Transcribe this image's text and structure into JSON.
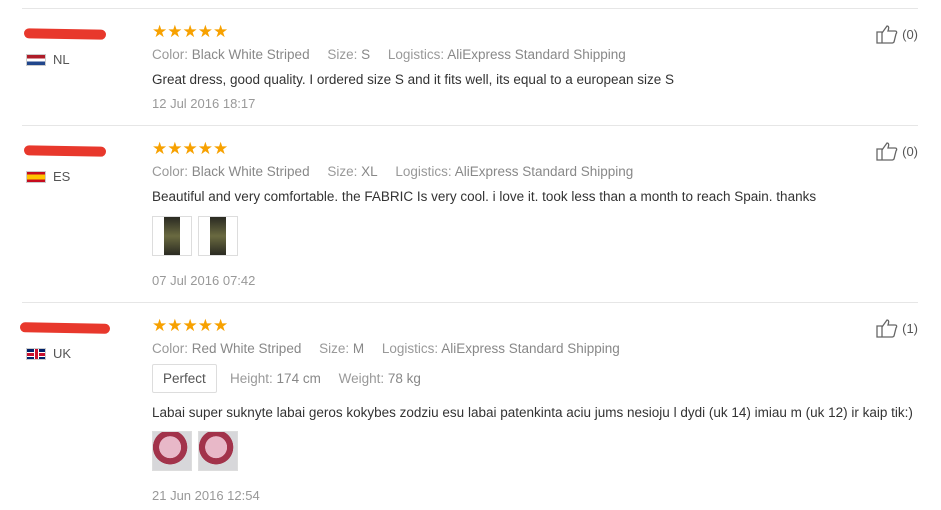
{
  "labels": {
    "color": "Color:",
    "size": "Size:",
    "logistics": "Logistics:",
    "height": "Height:",
    "weight": "Weight:"
  },
  "reviews": [
    {
      "country": "NL",
      "stars": "★★★★★",
      "color": "Black White Striped",
      "size": "S",
      "logistics": "AliExpress Standard Shipping",
      "text": "Great dress, good quality. I ordered size S and it fits well, its equal to a european size S",
      "date": "12 Jul 2016 18:17",
      "helpful": "(0)"
    },
    {
      "country": "ES",
      "stars": "★★★★★",
      "color": "Black White Striped",
      "size": "XL",
      "logistics": "AliExpress Standard Shipping",
      "text": "Beautiful and very comfortable. the FABRIC Is very cool. i love it. took less than a month to reach Spain. thanks",
      "date": "07 Jul 2016 07:42",
      "helpful": "(0)"
    },
    {
      "country": "UK",
      "stars": "★★★★★",
      "color": "Red White Striped",
      "size": "M",
      "logistics": "AliExpress Standard Shipping",
      "fit": "Perfect",
      "height": "174 cm",
      "weight": "78 kg",
      "text": "Labai super suknyte labai geros kokybes zodziu esu labai patenkinta aciu jums nesioju l dydi (uk 14) imiau m (uk 12) ir kaip tik:)",
      "date": "21 Jun 2016 12:54",
      "helpful": "(1)"
    }
  ],
  "icons": {
    "like": "thumbs-up-icon",
    "photo": "review-photo"
  },
  "colors": {
    "stars": "#f7a100",
    "redaction": "#e8382c"
  }
}
